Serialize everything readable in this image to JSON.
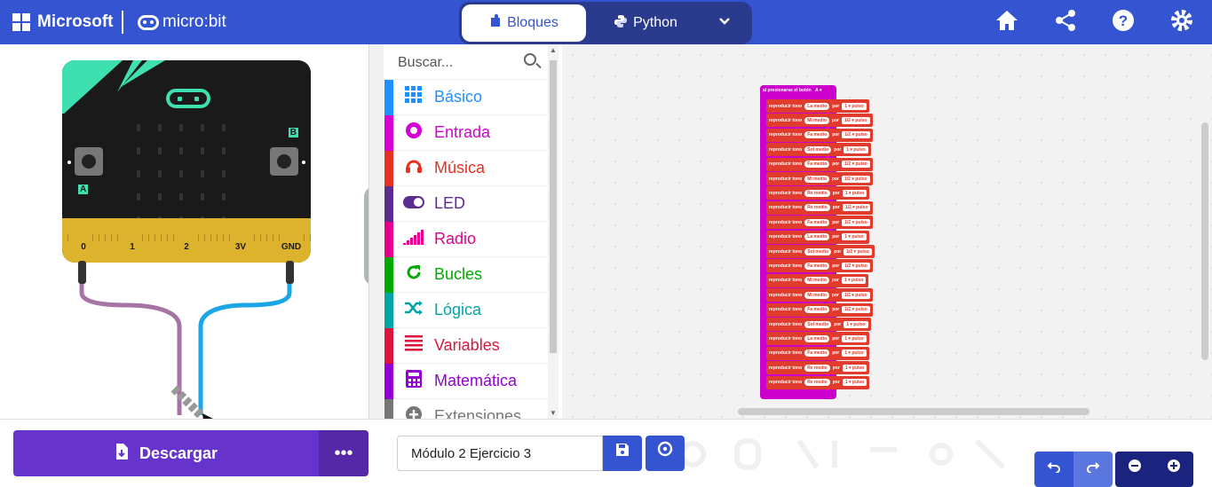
{
  "header": {
    "brand": "Microsoft",
    "product": "micro:bit",
    "modes": [
      {
        "label": "Bloques",
        "active": true
      },
      {
        "label": "Python",
        "active": false
      }
    ],
    "icons": [
      "home-icon",
      "share-icon",
      "help-icon",
      "settings-icon"
    ]
  },
  "simulator": {
    "button_a": "A",
    "button_b": "B",
    "pins": [
      "0",
      "1",
      "2",
      "3V",
      "GND"
    ]
  },
  "toolbox": {
    "search_placeholder": "Buscar...",
    "categories": [
      {
        "label": "Básico",
        "color": "#1e90ff",
        "icon": "grid-icon"
      },
      {
        "label": "Entrada",
        "color": "#d400d4",
        "icon": "target-icon"
      },
      {
        "label": "Música",
        "color": "#e63022",
        "icon": "headphones-icon"
      },
      {
        "label": "LED",
        "color": "#5c2d91",
        "icon": "toggle-icon"
      },
      {
        "label": "Radio",
        "color": "#e3008c",
        "icon": "signal-icon"
      },
      {
        "label": "Bucles",
        "color": "#00aa00",
        "icon": "refresh-icon"
      },
      {
        "label": "Lógica",
        "color": "#00a4a6",
        "icon": "shuffle-icon"
      },
      {
        "label": "Variables",
        "color": "#dc143c",
        "icon": "list-icon"
      },
      {
        "label": "Matemática",
        "color": "#9400d3",
        "icon": "calculator-icon"
      },
      {
        "label": "Extensiones",
        "color": "#777777",
        "icon": "plus-circle-icon"
      }
    ]
  },
  "workspace": {
    "event_label": "al presionarse el botón",
    "event_button": "A",
    "notes": [
      {
        "cmd": "reproducir tono",
        "tone": "La medio",
        "por": "por",
        "beat": "1",
        "unit": "pulso"
      },
      {
        "cmd": "reproducir tono",
        "tone": "Mi medio",
        "por": "por",
        "beat": "1/2",
        "unit": "pulso"
      },
      {
        "cmd": "reproducir tono",
        "tone": "Fa medio",
        "por": "por",
        "beat": "1/2",
        "unit": "pulso"
      },
      {
        "cmd": "reproducir tono",
        "tone": "Sol medio",
        "por": "por",
        "beat": "1",
        "unit": "pulso"
      },
      {
        "cmd": "reproducir tono",
        "tone": "Fa medio",
        "por": "por",
        "beat": "1/2",
        "unit": "pulso"
      },
      {
        "cmd": "reproducir tono",
        "tone": "Mi medio",
        "por": "por",
        "beat": "1/2",
        "unit": "pulso"
      },
      {
        "cmd": "reproducir tono",
        "tone": "Re medio",
        "por": "por",
        "beat": "1",
        "unit": "pulso"
      },
      {
        "cmd": "reproducir tono",
        "tone": "Re medio",
        "por": "por",
        "beat": "1/2",
        "unit": "pulso"
      },
      {
        "cmd": "reproducir tono",
        "tone": "Fa medio",
        "por": "por",
        "beat": "1/2",
        "unit": "pulso"
      },
      {
        "cmd": "reproducir tono",
        "tone": "La medio",
        "por": "por",
        "beat": "1",
        "unit": "pulso"
      },
      {
        "cmd": "reproducir tono",
        "tone": "Sol medio",
        "por": "por",
        "beat": "1/2",
        "unit": "pulso"
      },
      {
        "cmd": "reproducir tono",
        "tone": "Fa medio",
        "por": "por",
        "beat": "1/2",
        "unit": "pulso"
      },
      {
        "cmd": "reproducir tono",
        "tone": "Mi medio",
        "por": "por",
        "beat": "1",
        "unit": "pulso"
      },
      {
        "cmd": "reproducir tono",
        "tone": "Mi medio",
        "por": "por",
        "beat": "1/2",
        "unit": "pulso"
      },
      {
        "cmd": "reproducir tono",
        "tone": "Fa medio",
        "por": "por",
        "beat": "1/2",
        "unit": "pulso"
      },
      {
        "cmd": "reproducir tono",
        "tone": "Sol medio",
        "por": "por",
        "beat": "1",
        "unit": "pulso"
      },
      {
        "cmd": "reproducir tono",
        "tone": "La medio",
        "por": "por",
        "beat": "1",
        "unit": "pulso"
      },
      {
        "cmd": "reproducir tono",
        "tone": "Fa medio",
        "por": "por",
        "beat": "1",
        "unit": "pulso"
      },
      {
        "cmd": "reproducir tono",
        "tone": "Re medio",
        "por": "por",
        "beat": "1",
        "unit": "pulso"
      },
      {
        "cmd": "reproducir tono",
        "tone": "Re medio",
        "por": "por",
        "beat": "1",
        "unit": "pulso"
      }
    ]
  },
  "footer": {
    "download_label": "Descargar",
    "more_label": "•••",
    "project_name": "Módulo 2 Ejercicio 3"
  }
}
